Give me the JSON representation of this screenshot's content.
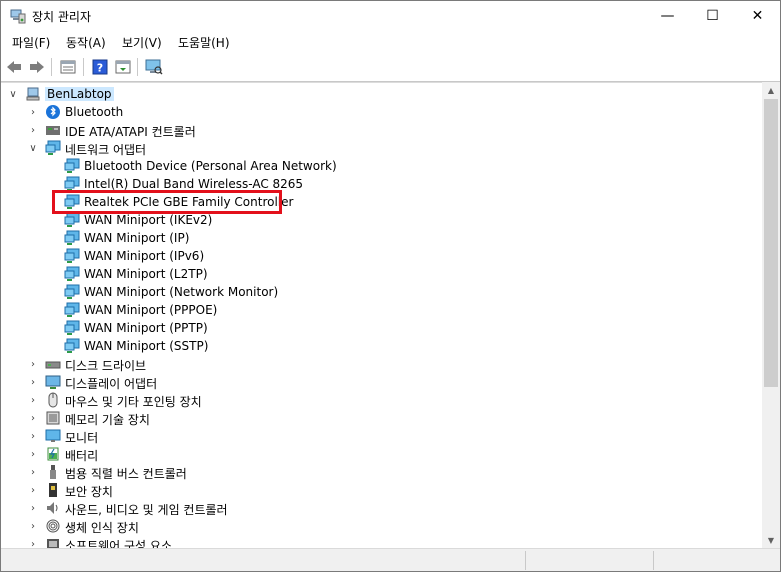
{
  "window": {
    "title": "장치 관리자",
    "controls": {
      "minimize": "—",
      "maximize": "☐",
      "close": "✕"
    }
  },
  "menu": [
    "파일(F)",
    "동작(A)",
    "보기(V)",
    "도움말(H)"
  ],
  "toolbar": [
    "back-icon",
    "forward-icon",
    "properties-icon",
    "help-icon",
    "update-driver-icon",
    "scan-hardware-icon"
  ],
  "tree": {
    "root": "BenLabtop",
    "nodes": [
      {
        "label": "Bluetooth",
        "icon": "bluetooth-icon",
        "expanded": false
      },
      {
        "label": "IDE ATA/ATAPI 컨트롤러",
        "icon": "ide-controller-icon",
        "expanded": false
      },
      {
        "label": "네트워크 어댑터",
        "icon": "network-adapter-icon",
        "expanded": true,
        "children": [
          "Bluetooth Device (Personal Area Network)",
          "Intel(R) Dual Band Wireless-AC 8265",
          "Realtek PCIe GBE Family Controller",
          "WAN Miniport (IKEv2)",
          "WAN Miniport (IP)",
          "WAN Miniport (IPv6)",
          "WAN Miniport (L2TP)",
          "WAN Miniport (Network Monitor)",
          "WAN Miniport (PPPOE)",
          "WAN Miniport (PPTP)",
          "WAN Miniport (SSTP)"
        ]
      },
      {
        "label": "디스크 드라이브",
        "icon": "disk-drive-icon",
        "expanded": false
      },
      {
        "label": "디스플레이 어댑터",
        "icon": "display-adapter-icon",
        "expanded": false
      },
      {
        "label": "마우스 및 기타 포인팅 장치",
        "icon": "mouse-icon",
        "expanded": false
      },
      {
        "label": "메모리 기술 장치",
        "icon": "memory-device-icon",
        "expanded": false
      },
      {
        "label": "모니터",
        "icon": "monitor-icon",
        "expanded": false
      },
      {
        "label": "배터리",
        "icon": "battery-icon",
        "expanded": false
      },
      {
        "label": "범용 직렬 버스 컨트롤러",
        "icon": "usb-icon",
        "expanded": false
      },
      {
        "label": "보안 장치",
        "icon": "security-device-icon",
        "expanded": false
      },
      {
        "label": "사운드, 비디오 및 게임 컨트롤러",
        "icon": "sound-icon",
        "expanded": false
      },
      {
        "label": "생체 인식 장치",
        "icon": "biometric-icon",
        "expanded": false
      },
      {
        "label": "소프트웨어 구성 요소",
        "icon": "software-component-icon",
        "expanded": false
      }
    ],
    "highlighted": "Realtek PCIe GBE Family Controller"
  },
  "colors": {
    "highlight_border": "#e3101b",
    "selection_bg": "#cce8ff",
    "network_icon": "#1e90c8"
  }
}
